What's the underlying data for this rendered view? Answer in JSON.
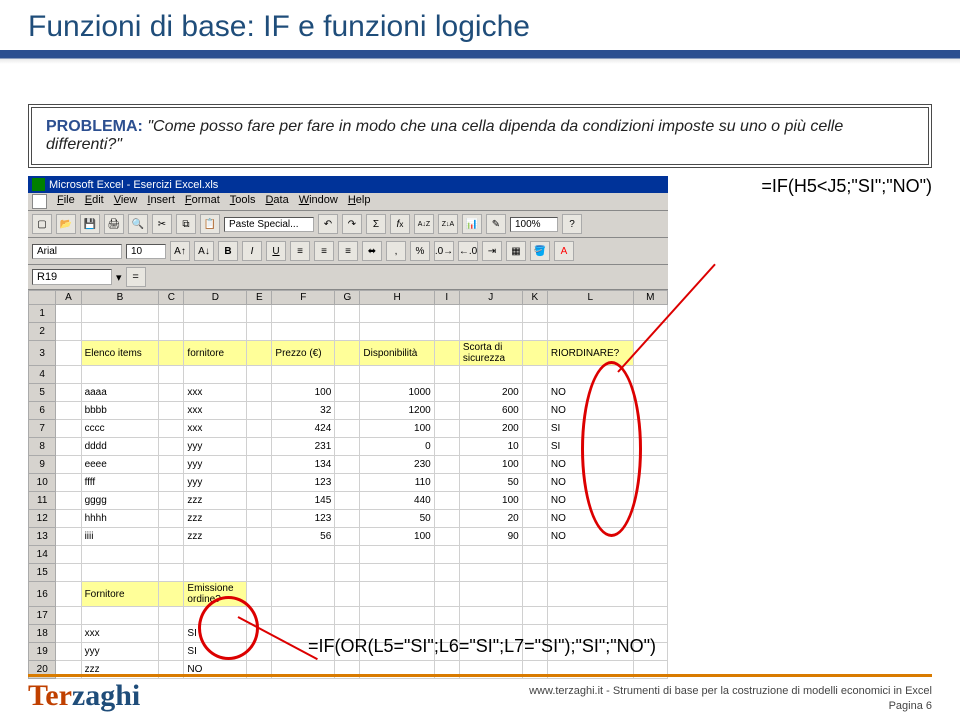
{
  "title": "Funzioni di base: IF e funzioni logiche",
  "problem": {
    "label": "PROBLEMA:",
    "text": "\"Come posso fare per fare in modo che una cella dipenda da condizioni imposte su uno o più celle differenti?\""
  },
  "formula1": "=IF(H5<J5;\"SI\";\"NO\")",
  "formula2": "=IF(OR(L5=\"SI\";L6=\"SI\";L7=\"SI\");\"SI\";\"NO\")",
  "excel": {
    "title": "Microsoft Excel - Esercizi Excel.xls",
    "menus": [
      "File",
      "Edit",
      "View",
      "Insert",
      "Format",
      "Tools",
      "Data",
      "Window",
      "Help"
    ],
    "paste_btn": "Paste Special...",
    "zoom": "100%",
    "font": "Arial",
    "font_size": "10",
    "name_box": "R19",
    "formula_eq": "=",
    "columns": [
      "",
      "A",
      "B",
      "C",
      "D",
      "E",
      "F",
      "G",
      "H",
      "I",
      "J",
      "K",
      "L",
      "M"
    ],
    "headers_row3": {
      "B": "Elenco items",
      "D": "fornitore",
      "F": "Prezzo (€)",
      "H": "Disponibilità",
      "J": "Scorta di sicurezza",
      "L": "RIORDINARE?"
    },
    "rows": [
      {
        "n": 5,
        "B": "aaaa",
        "D": "xxx",
        "F": "100",
        "H": "1000",
        "J": "200",
        "L": "NO"
      },
      {
        "n": 6,
        "B": "bbbb",
        "D": "xxx",
        "F": "32",
        "H": "1200",
        "J": "600",
        "L": "NO"
      },
      {
        "n": 7,
        "B": "cccc",
        "D": "xxx",
        "F": "424",
        "H": "100",
        "J": "200",
        "L": "SI"
      },
      {
        "n": 8,
        "B": "dddd",
        "D": "yyy",
        "F": "231",
        "H": "0",
        "J": "10",
        "L": "SI"
      },
      {
        "n": 9,
        "B": "eeee",
        "D": "yyy",
        "F": "134",
        "H": "230",
        "J": "100",
        "L": "NO"
      },
      {
        "n": 10,
        "B": "ffff",
        "D": "yyy",
        "F": "123",
        "H": "110",
        "J": "50",
        "L": "NO"
      },
      {
        "n": 11,
        "B": "gggg",
        "D": "zzz",
        "F": "145",
        "H": "440",
        "J": "100",
        "L": "NO"
      },
      {
        "n": 12,
        "B": "hhhh",
        "D": "zzz",
        "F": "123",
        "H": "50",
        "J": "20",
        "L": "NO"
      },
      {
        "n": 13,
        "B": "iiii",
        "D": "zzz",
        "F": "56",
        "H": "100",
        "J": "90",
        "L": "NO"
      }
    ],
    "row16": {
      "B": "Fornitore",
      "D": "Emissione ordine?"
    },
    "bottom_rows": [
      {
        "n": 18,
        "B": "xxx",
        "D": "SI"
      },
      {
        "n": 19,
        "B": "yyy",
        "D": "SI"
      },
      {
        "n": 20,
        "B": "zzz",
        "D": "NO"
      }
    ]
  },
  "footer": {
    "logo_part1": "Ter",
    "logo_part2": "zaghi",
    "line1": "www.terzaghi.it - Strumenti di base per la costruzione di modelli economici in Excel",
    "line2": "Pagina 6"
  }
}
